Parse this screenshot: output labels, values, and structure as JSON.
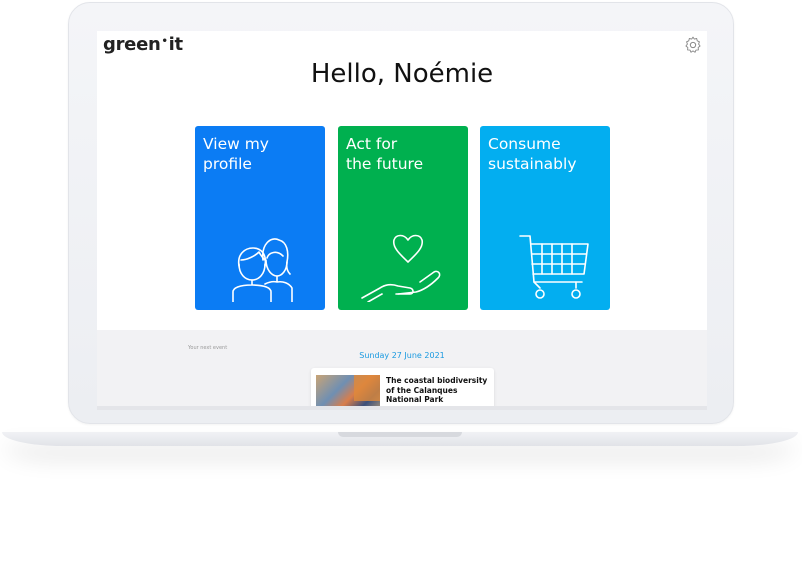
{
  "app": {
    "logo_left": "green",
    "logo_dot": "•",
    "logo_right": "it"
  },
  "header": {
    "greeting": "Hello, Noémie"
  },
  "tiles": [
    {
      "label": "View my\nprofile",
      "icon": "people-icon",
      "color": "#0b7cf4"
    },
    {
      "label": "Act for\nthe future",
      "icon": "heart-hand-icon",
      "color": "#00b04f"
    },
    {
      "label": "Consume\nsustainably",
      "icon": "cart-icon",
      "color": "#03aef0"
    }
  ],
  "events": {
    "section_label": "Your next event",
    "date": "Sunday 27 June 2021",
    "card_title": "The coastal biodiversity of the Calanques National Park"
  }
}
